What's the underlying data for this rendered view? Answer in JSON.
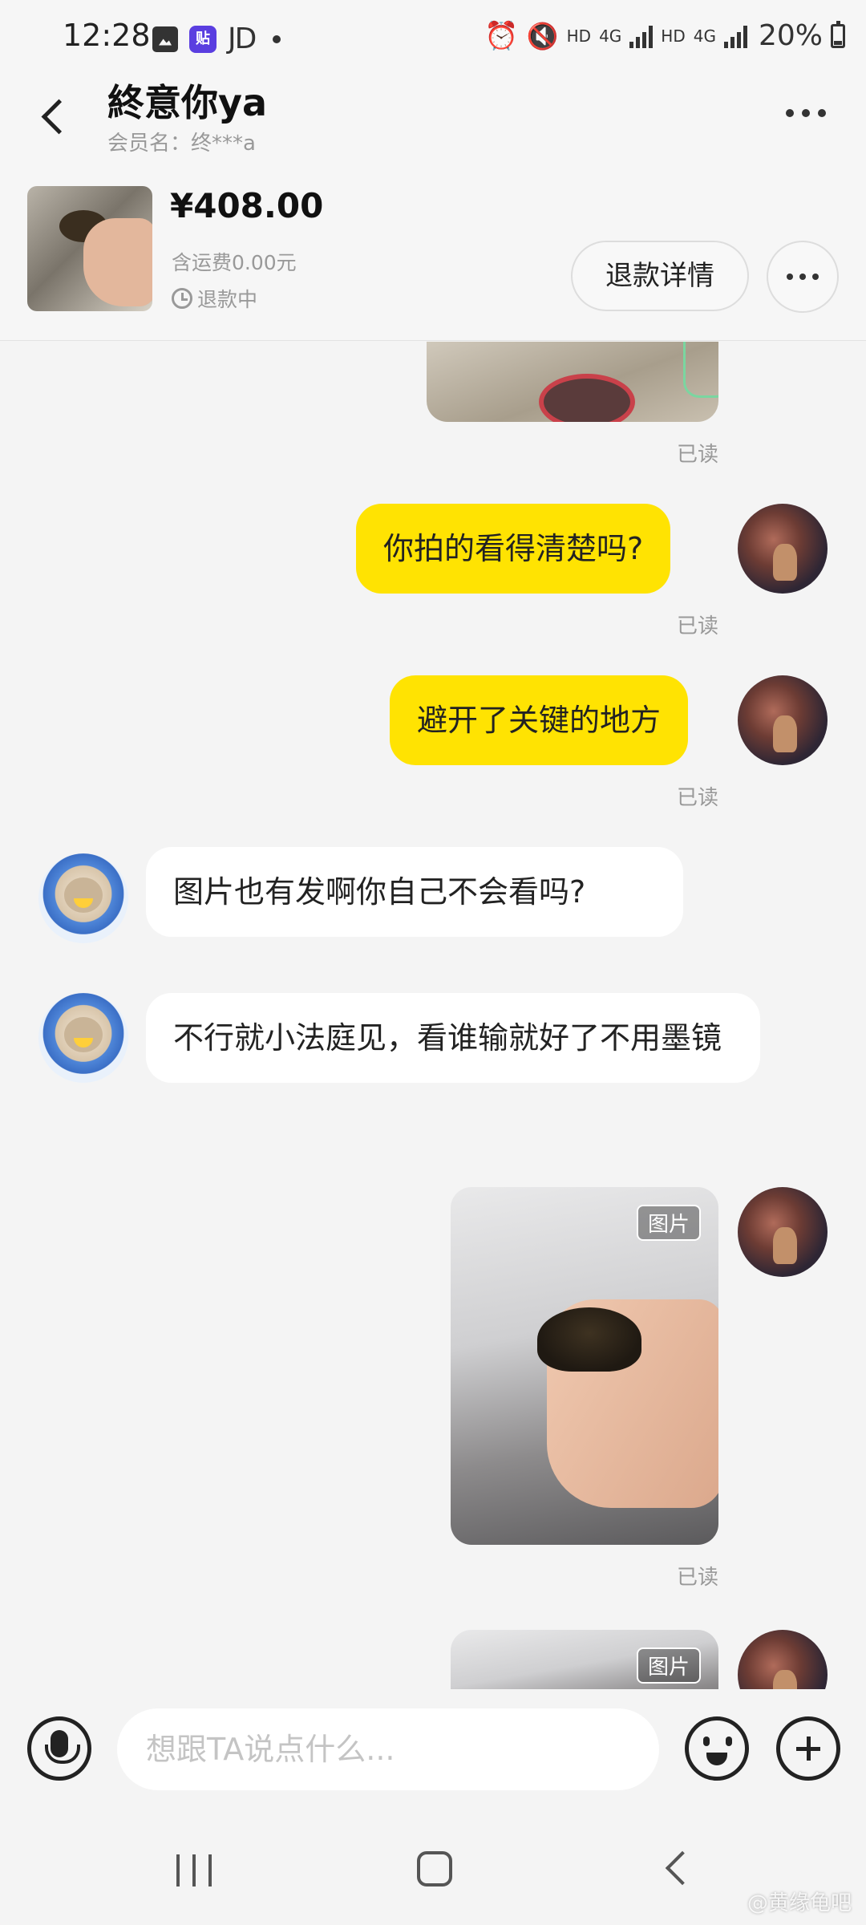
{
  "status_bar": {
    "time": "12:28",
    "jd_label": "JD",
    "tieba_label": "贴",
    "network_1": "HD",
    "network_2": "4G",
    "network_3": "HD",
    "network_4": "4G",
    "battery": "20%"
  },
  "header": {
    "title": "終意你ya",
    "subtitle": "会员名：终***a"
  },
  "product": {
    "price": "¥408.00",
    "shipping": "含运费0.00元",
    "status": "退款中",
    "refund_button": "退款详情"
  },
  "messages": {
    "read_label": "已读",
    "m1": "你拍的看得清楚吗?",
    "m2": "避开了关键的地方",
    "m3": "图片也有发啊你自己不会看吗?",
    "m4": "不行就小法庭见，看谁输就好了不用墨镜",
    "photo_tag": "图片"
  },
  "input": {
    "placeholder": "想跟TA说点什么..."
  },
  "watermark": "@黄缘龟吧",
  "colors": {
    "my_bubble": "#ffe302",
    "other_bubble": "#ffffff",
    "background": "#f4f4f4"
  }
}
